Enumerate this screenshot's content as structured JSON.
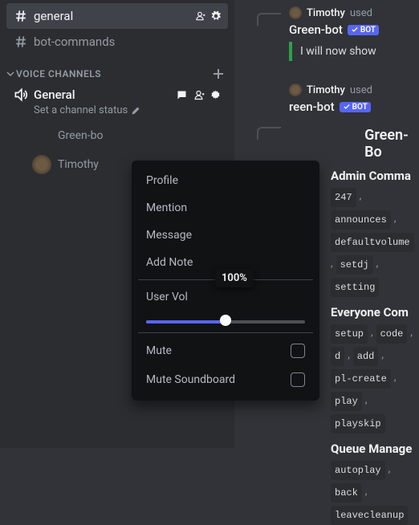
{
  "sidebar": {
    "channels": [
      {
        "name": "general",
        "active": true
      },
      {
        "name": "bot-commands",
        "active": false
      }
    ],
    "voice_section": "VOICE CHANNELS",
    "voice_channel": {
      "name": "General",
      "status": "Set a channel status"
    },
    "voice_users": [
      {
        "name": "Green-bo",
        "avatar": "greenbot"
      },
      {
        "name": "Timothy",
        "avatar": "timothy"
      }
    ]
  },
  "context_menu": {
    "profile": "Profile",
    "mention": "Mention",
    "message": "Message",
    "add_note": "Add Note",
    "user_volume_label": "User Vol",
    "volume_tooltip": "100%",
    "mute": "Mute",
    "mute_soundboard": "Mute Soundboard"
  },
  "chat": {
    "reply1": {
      "user": "Timothy",
      "text": "used"
    },
    "msg1": {
      "name": "Green-bot",
      "bot_tag": "BOT",
      "embed": "I will now show"
    },
    "reply2": {
      "user": "Timothy",
      "text": "used"
    },
    "msg2": {
      "name": "reen-bot",
      "bot_tag": "BOT"
    },
    "detail": {
      "name": "Green-Bo",
      "sections": [
        {
          "heading": "Admin Comma",
          "items": [
            "247",
            "announces",
            "defaultvolume",
            "setdj",
            "setting"
          ]
        },
        {
          "heading": "Everyone Com",
          "items": [
            "setup",
            "code",
            "d",
            "add",
            "pl-create",
            "play",
            "playskip"
          ]
        },
        {
          "heading": "Queue Manage",
          "items": [
            "autoplay",
            "back",
            "leavecleanup"
          ]
        }
      ]
    }
  }
}
